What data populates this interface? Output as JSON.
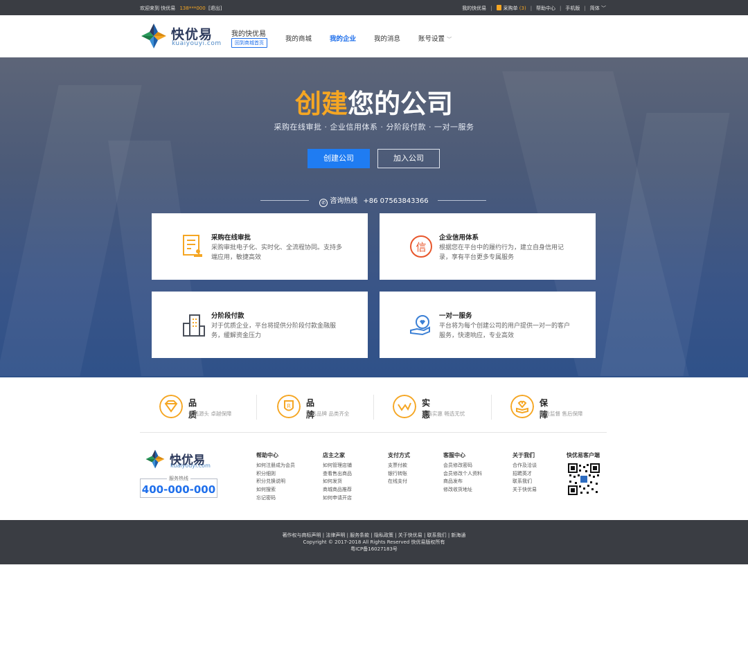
{
  "topbar": {
    "welcome": "欢迎来到 快优易",
    "phone": "138***000",
    "logout": "[退出]",
    "my_account": "我的快优易",
    "cart_label": "采购单",
    "cart_count": "(3)",
    "help": "帮助中心",
    "mobile": "手机版",
    "lang": "简体"
  },
  "header": {
    "logo_name": "快优易",
    "logo_pinyin": "kuaiyouyi.com",
    "my_title": "我的快优易",
    "back_label": "回到商城首页",
    "nav": [
      {
        "label": "我的商城"
      },
      {
        "label": "我的企业"
      },
      {
        "label": "我的消息"
      },
      {
        "label": "账号设置"
      }
    ]
  },
  "hero": {
    "title_highlight": "创建",
    "title_rest": "您的公司",
    "subtitle": "采购在线审批  ·  企业信用体系  ·  分阶段付款  ·  一对一服务",
    "create_button": "创建公司",
    "join_button": "加入公司",
    "hotline_label": "咨询热线",
    "hotline_number": "+86 07563843366"
  },
  "cards": [
    {
      "title": "采购在线审批",
      "desc": "采购审批电子化、实时化、全流程协同。支持多端应用，敏捷高效",
      "icon": "document-approval-icon"
    },
    {
      "title": "企业信用体系",
      "desc": "根据您在平台中的履约行为，建立自身信用记录，享有平台更多专属服务",
      "icon": "credit-seal-icon"
    },
    {
      "title": "分阶段付款",
      "desc": "对于优质企业，平台将提供分阶段付款金融服务，缓解资金压力",
      "icon": "building-icon"
    },
    {
      "title": "一对一服务",
      "desc": "平台将为每个创建公司的用户提供一对一的客户服务，快速响应，专业高效",
      "icon": "hand-heart-icon"
    }
  ],
  "features": [
    {
      "title": "品质",
      "desc": "优选源头  卓越保障",
      "icon": "diamond-icon"
    },
    {
      "title": "品牌",
      "desc": "知名品牌  品类齐全",
      "icon": "brand-shield-icon"
    },
    {
      "title": "实惠",
      "desc": "价格实惠  畅选无忧",
      "icon": "price-wave-icon"
    },
    {
      "title": "保障",
      "desc": "质检监督  售后保障",
      "icon": "heart-hand-icon"
    }
  ],
  "footer": {
    "logo_name": "快优易",
    "logo_pinyin": "kuaiyouyi.com",
    "service_label": "服务热线",
    "service_tel": "400-000-000",
    "columns": [
      {
        "heading": "帮助中心",
        "items": [
          "如何注册成为会员",
          "积分细则",
          "积分兑换说明",
          "如何搜索",
          "忘记密码"
        ]
      },
      {
        "heading": "店主之家",
        "items": [
          "如何管理店铺",
          "查看售出商品",
          "如何发货",
          "商城商品推荐",
          "如何申请开店"
        ]
      },
      {
        "heading": "支付方式",
        "items": [
          "支票付款",
          "银行转账",
          "在线支付"
        ]
      },
      {
        "heading": "客服中心",
        "items": [
          "会员修改密码",
          "会员修改个人资料",
          "商品发布",
          "修改收货地址"
        ]
      },
      {
        "heading": "关于我们",
        "items": [
          "合作及洽谈",
          "招聘英才",
          "联系我们",
          "关于快优易"
        ]
      }
    ],
    "qr_title": "快优易客户端"
  },
  "bottom": {
    "links": "著作权与商标声明 | 法律声明 | 服务条款 | 隐私政策 | 关于快优易 | 联系我们 | 新海通",
    "copyright": "Copyright © 2017-2018 All Rights Reserved 快优易版权所有",
    "icp": "粤ICP备16027183号"
  },
  "colors": {
    "accent_blue": "#1f7cf2",
    "accent_orange": "#f5a623",
    "dark_bar": "#3a3d43"
  }
}
